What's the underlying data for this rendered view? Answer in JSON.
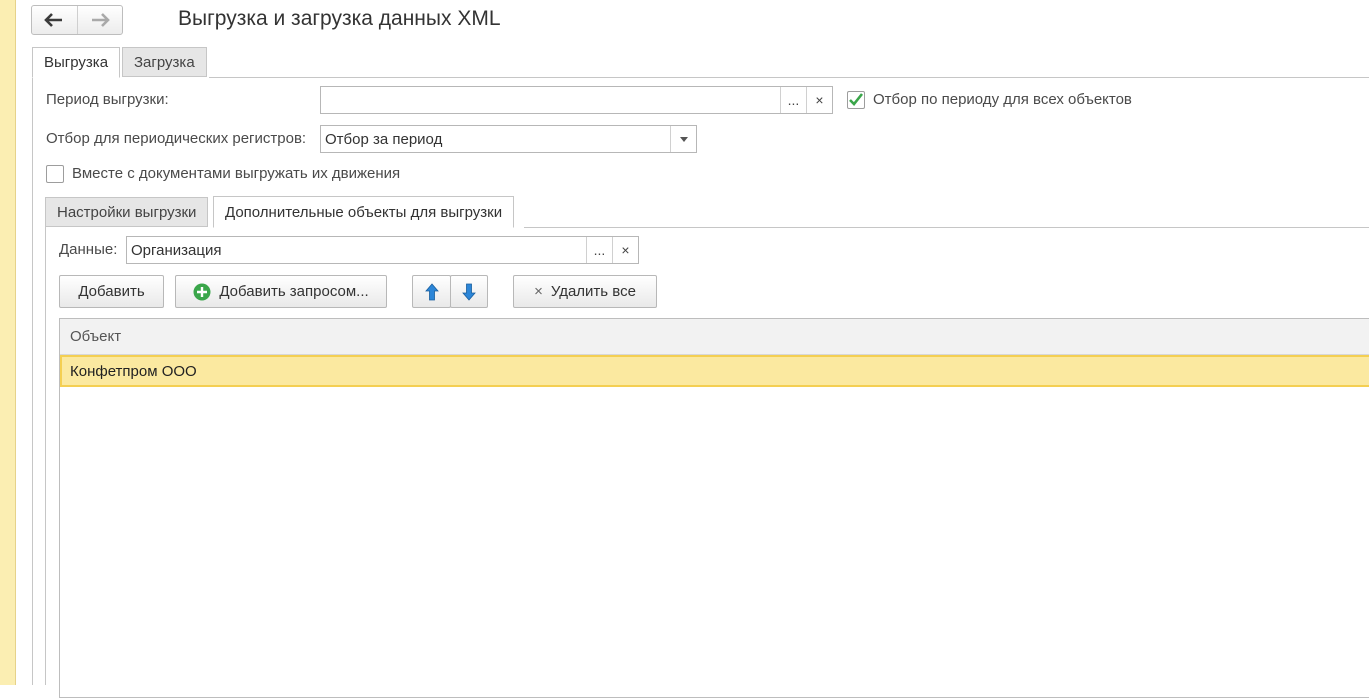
{
  "header": {
    "title": "Выгрузка и загрузка данных XML",
    "back_icon": "arrow-left-icon",
    "forward_icon": "arrow-right-icon"
  },
  "main_tabs": [
    {
      "label": "Выгрузка",
      "active": true
    },
    {
      "label": "Загрузка",
      "active": false
    }
  ],
  "export_form": {
    "period_label": "Период выгрузки:",
    "period_value": "",
    "period_select_label": "...",
    "period_clear_label": "×",
    "period_filter_checkbox": {
      "label": "Отбор по периоду для всех объектов",
      "checked": true
    },
    "periodic_label": "Отбор для периодических регистров:",
    "periodic_value": "Отбор за период",
    "movements_checkbox": {
      "label": "Вместе с документами выгружать их движения",
      "checked": false
    }
  },
  "sub_tabs": [
    {
      "label": "Настройки выгрузки",
      "active": false
    },
    {
      "label": "Дополнительные объекты для выгрузки",
      "active": true
    }
  ],
  "extra_objects": {
    "data_label": "Данные:",
    "data_value": "Организация",
    "data_select_label": "...",
    "data_clear_label": "×",
    "toolbar": {
      "add_label": "Добавить",
      "add_query_label": "Добавить запросом...",
      "delete_all_label": "Удалить все",
      "delete_all_icon": "×"
    },
    "table": {
      "columns": [
        "Объект"
      ],
      "rows": [
        {
          "object": "Конфетпром ООО",
          "selected": true
        }
      ]
    }
  },
  "colors": {
    "accent_green": "#3aa64a",
    "arrow_blue": "#2c86d8",
    "selection_fill": "#fbe9a0",
    "selection_border": "#f4cf52",
    "side_strip": "#fbeeb2"
  }
}
